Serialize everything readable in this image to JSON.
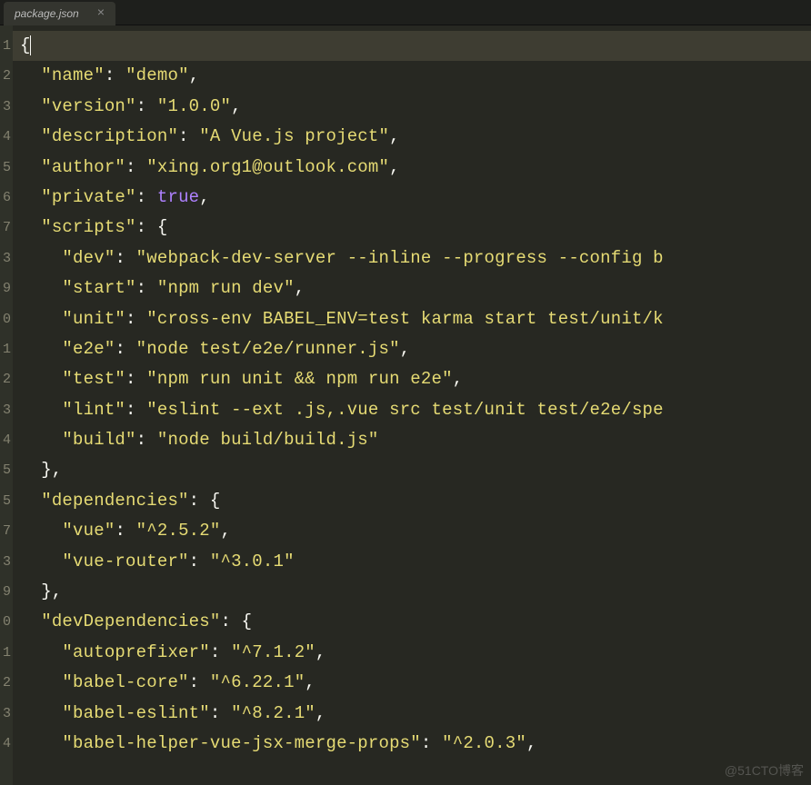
{
  "tab": {
    "label": "package.json",
    "close": "×"
  },
  "gutter": [
    "1",
    "2",
    "3",
    "4",
    "5",
    "6",
    "7",
    "3",
    "9",
    "0",
    "1",
    "2",
    "3",
    "4",
    "5",
    "5",
    "7",
    "3",
    "9",
    "0",
    "1",
    "2",
    "3",
    "4"
  ],
  "code": {
    "lines": [
      {
        "tokens": [
          {
            "cls": "punct",
            "t": "{"
          }
        ],
        "active": true,
        "cursor": true
      },
      {
        "tokens": [
          {
            "cls": "punct",
            "t": "  "
          },
          {
            "cls": "key",
            "t": "\"name\""
          },
          {
            "cls": "punct",
            "t": ": "
          },
          {
            "cls": "string",
            "t": "\"demo\""
          },
          {
            "cls": "punct",
            "t": ","
          }
        ]
      },
      {
        "tokens": [
          {
            "cls": "punct",
            "t": "  "
          },
          {
            "cls": "key",
            "t": "\"version\""
          },
          {
            "cls": "punct",
            "t": ": "
          },
          {
            "cls": "string",
            "t": "\"1.0.0\""
          },
          {
            "cls": "punct",
            "t": ","
          }
        ]
      },
      {
        "tokens": [
          {
            "cls": "punct",
            "t": "  "
          },
          {
            "cls": "key",
            "t": "\"description\""
          },
          {
            "cls": "punct",
            "t": ": "
          },
          {
            "cls": "string",
            "t": "\"A Vue.js project\""
          },
          {
            "cls": "punct",
            "t": ","
          }
        ]
      },
      {
        "tokens": [
          {
            "cls": "punct",
            "t": "  "
          },
          {
            "cls": "key",
            "t": "\"author\""
          },
          {
            "cls": "punct",
            "t": ": "
          },
          {
            "cls": "string",
            "t": "\"xing.org1@outlook.com\""
          },
          {
            "cls": "punct",
            "t": ","
          }
        ]
      },
      {
        "tokens": [
          {
            "cls": "punct",
            "t": "  "
          },
          {
            "cls": "key",
            "t": "\"private\""
          },
          {
            "cls": "punct",
            "t": ": "
          },
          {
            "cls": "bool",
            "t": "true"
          },
          {
            "cls": "punct",
            "t": ","
          }
        ]
      },
      {
        "tokens": [
          {
            "cls": "punct",
            "t": "  "
          },
          {
            "cls": "key",
            "t": "\"scripts\""
          },
          {
            "cls": "punct",
            "t": ": {"
          }
        ]
      },
      {
        "tokens": [
          {
            "cls": "punct",
            "t": "    "
          },
          {
            "cls": "key",
            "t": "\"dev\""
          },
          {
            "cls": "punct",
            "t": ": "
          },
          {
            "cls": "string",
            "t": "\"webpack-dev-server --inline --progress --config b"
          }
        ]
      },
      {
        "tokens": [
          {
            "cls": "punct",
            "t": "    "
          },
          {
            "cls": "key",
            "t": "\"start\""
          },
          {
            "cls": "punct",
            "t": ": "
          },
          {
            "cls": "string",
            "t": "\"npm run dev\""
          },
          {
            "cls": "punct",
            "t": ","
          }
        ]
      },
      {
        "tokens": [
          {
            "cls": "punct",
            "t": "    "
          },
          {
            "cls": "key",
            "t": "\"unit\""
          },
          {
            "cls": "punct",
            "t": ": "
          },
          {
            "cls": "string",
            "t": "\"cross-env BABEL_ENV=test karma start test/unit/k"
          }
        ]
      },
      {
        "tokens": [
          {
            "cls": "punct",
            "t": "    "
          },
          {
            "cls": "key",
            "t": "\"e2e\""
          },
          {
            "cls": "punct",
            "t": ": "
          },
          {
            "cls": "string",
            "t": "\"node test/e2e/runner.js\""
          },
          {
            "cls": "punct",
            "t": ","
          }
        ]
      },
      {
        "tokens": [
          {
            "cls": "punct",
            "t": "    "
          },
          {
            "cls": "key",
            "t": "\"test\""
          },
          {
            "cls": "punct",
            "t": ": "
          },
          {
            "cls": "string",
            "t": "\"npm run unit && npm run e2e\""
          },
          {
            "cls": "punct",
            "t": ","
          }
        ]
      },
      {
        "tokens": [
          {
            "cls": "punct",
            "t": "    "
          },
          {
            "cls": "key",
            "t": "\"lint\""
          },
          {
            "cls": "punct",
            "t": ": "
          },
          {
            "cls": "string",
            "t": "\"eslint --ext .js,.vue src test/unit test/e2e/spe"
          }
        ]
      },
      {
        "tokens": [
          {
            "cls": "punct",
            "t": "    "
          },
          {
            "cls": "key",
            "t": "\"build\""
          },
          {
            "cls": "punct",
            "t": ": "
          },
          {
            "cls": "string",
            "t": "\"node build/build.js\""
          }
        ]
      },
      {
        "tokens": [
          {
            "cls": "punct",
            "t": "  },"
          }
        ]
      },
      {
        "tokens": [
          {
            "cls": "punct",
            "t": "  "
          },
          {
            "cls": "key",
            "t": "\"dependencies\""
          },
          {
            "cls": "punct",
            "t": ": {"
          }
        ]
      },
      {
        "tokens": [
          {
            "cls": "punct",
            "t": "    "
          },
          {
            "cls": "key",
            "t": "\"vue\""
          },
          {
            "cls": "punct",
            "t": ": "
          },
          {
            "cls": "string",
            "t": "\"^2.5.2\""
          },
          {
            "cls": "punct",
            "t": ","
          }
        ]
      },
      {
        "tokens": [
          {
            "cls": "punct",
            "t": "    "
          },
          {
            "cls": "key",
            "t": "\"vue-router\""
          },
          {
            "cls": "punct",
            "t": ": "
          },
          {
            "cls": "string",
            "t": "\"^3.0.1\""
          }
        ]
      },
      {
        "tokens": [
          {
            "cls": "punct",
            "t": "  },"
          }
        ]
      },
      {
        "tokens": [
          {
            "cls": "punct",
            "t": "  "
          },
          {
            "cls": "key",
            "t": "\"devDependencies\""
          },
          {
            "cls": "punct",
            "t": ": {"
          }
        ]
      },
      {
        "tokens": [
          {
            "cls": "punct",
            "t": "    "
          },
          {
            "cls": "key",
            "t": "\"autoprefixer\""
          },
          {
            "cls": "punct",
            "t": ": "
          },
          {
            "cls": "string",
            "t": "\"^7.1.2\""
          },
          {
            "cls": "punct",
            "t": ","
          }
        ]
      },
      {
        "tokens": [
          {
            "cls": "punct",
            "t": "    "
          },
          {
            "cls": "key",
            "t": "\"babel-core\""
          },
          {
            "cls": "punct",
            "t": ": "
          },
          {
            "cls": "string",
            "t": "\"^6.22.1\""
          },
          {
            "cls": "punct",
            "t": ","
          }
        ]
      },
      {
        "tokens": [
          {
            "cls": "punct",
            "t": "    "
          },
          {
            "cls": "key",
            "t": "\"babel-eslint\""
          },
          {
            "cls": "punct",
            "t": ": "
          },
          {
            "cls": "string",
            "t": "\"^8.2.1\""
          },
          {
            "cls": "punct",
            "t": ","
          }
        ]
      },
      {
        "tokens": [
          {
            "cls": "punct",
            "t": "    "
          },
          {
            "cls": "key",
            "t": "\"babel-helper-vue-jsx-merge-props\""
          },
          {
            "cls": "punct",
            "t": ": "
          },
          {
            "cls": "string",
            "t": "\"^2.0.3\""
          },
          {
            "cls": "punct",
            "t": ","
          }
        ]
      }
    ]
  },
  "watermark": "@51CTO博客"
}
